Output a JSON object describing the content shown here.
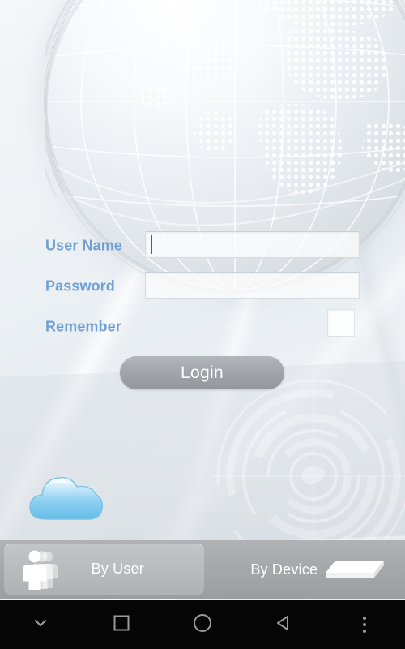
{
  "app": {
    "background_color": "#eef2f5",
    "accent_label_color": "#6f9fd4"
  },
  "form": {
    "username": {
      "label": "User Name",
      "value": "",
      "placeholder": "",
      "focused": true
    },
    "password": {
      "label": "Password",
      "value": "",
      "placeholder": ""
    },
    "remember": {
      "label": "Remember",
      "checked": false
    },
    "login_button": {
      "label": "Login",
      "color": "#a1a4a8",
      "text_color": "#fdfdfd"
    }
  },
  "decor": {
    "cloud_icon": "cloud-icon",
    "cloud_color": "#7fc6ec",
    "globe_icon": "dotted-globe-graphic",
    "radar_icon": "concentric-radar-graphic"
  },
  "tabbar": {
    "background_color": "#a7a9ad",
    "tabs": [
      {
        "label": "By User",
        "icon": "people-group-icon",
        "selected": true
      },
      {
        "label": "By Device",
        "icon": "device-box-icon",
        "selected": false
      }
    ]
  },
  "navbar": {
    "background_color": "#050505",
    "buttons": [
      {
        "name": "hide-keyboard-button",
        "icon": "chevron-down-icon"
      },
      {
        "name": "recents-button",
        "icon": "square-icon"
      },
      {
        "name": "home-button",
        "icon": "circle-icon"
      },
      {
        "name": "back-button",
        "icon": "triangle-left-icon"
      },
      {
        "name": "overflow-menu-button",
        "icon": "three-dots-icon"
      }
    ]
  }
}
